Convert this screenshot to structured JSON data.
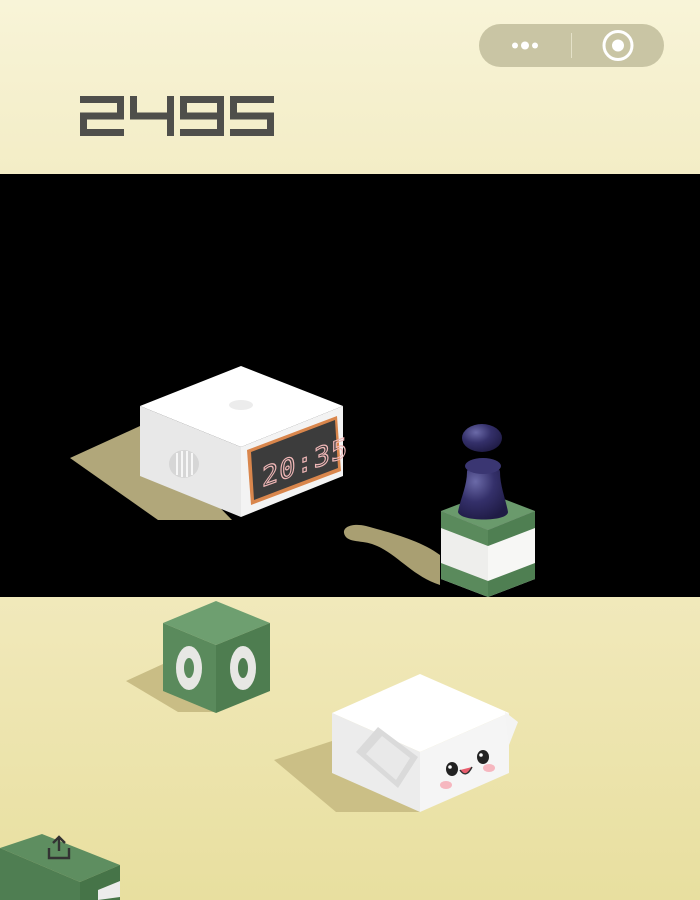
{
  "score": "2495",
  "clock_time": "20:35",
  "capsule": {
    "more_icon": "more-dots-icon",
    "close_icon": "record-target-icon"
  },
  "share_icon": "share-upload-icon",
  "colors": {
    "ground_top": "#f1e9bb",
    "ground_bottom": "#e8df9f",
    "score": "#4f4f4b",
    "green_block": "#5d8c5f",
    "player": "#2f2b63",
    "clock_digits": "#f0b7b7"
  }
}
